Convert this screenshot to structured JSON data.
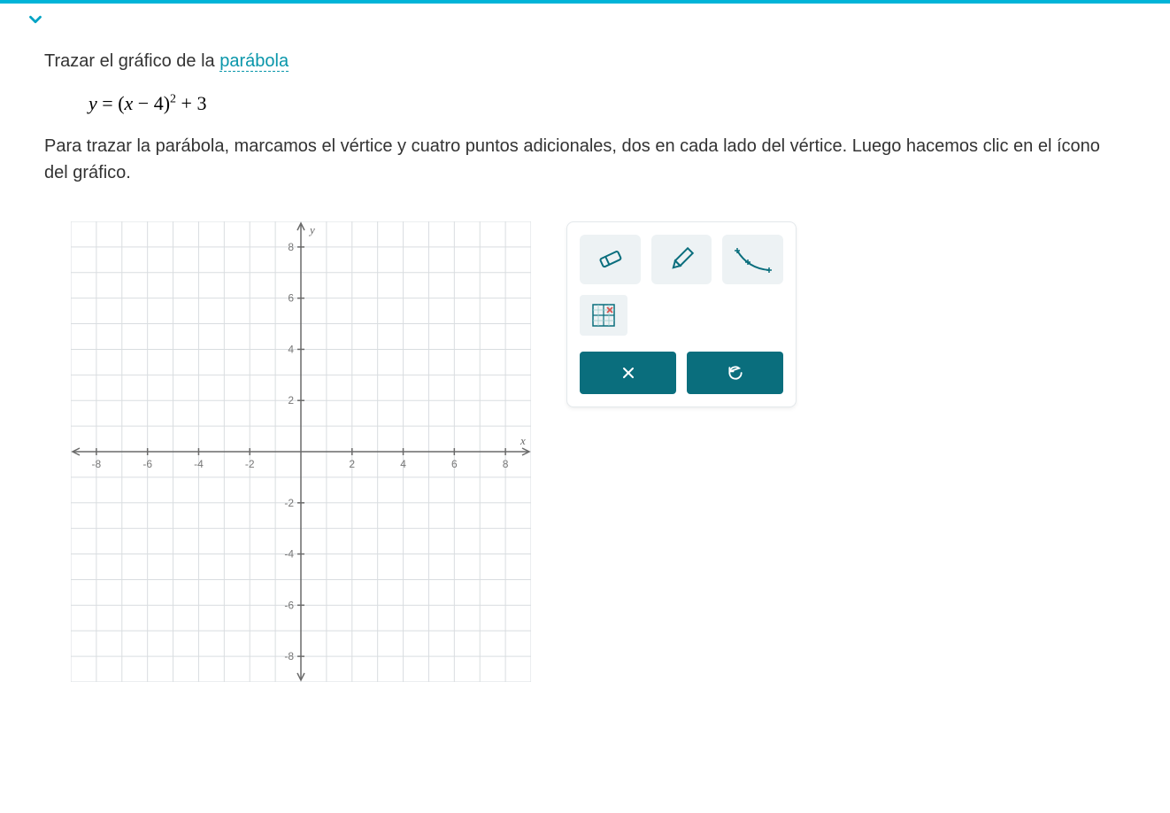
{
  "instruction_prefix": "Trazar el gráfico de la ",
  "instruction_link": "parábola",
  "equation": {
    "raw_tex": "y = (x - 4)^2 + 3",
    "lhs": "y",
    "rhs_open": "(",
    "var": "x",
    "minus": " − ",
    "h": "4",
    "rhs_close": ")",
    "exp": "2",
    "plus": " + ",
    "k": "3"
  },
  "sub_instruction": "Para trazar la parábola, marcamos el vértice y cuatro puntos adicionales, dos en cada lado del vértice. Luego hacemos clic en el ícono del gráfico.",
  "chart_data": {
    "type": "scatter",
    "title": "",
    "xlabel": "x",
    "ylabel": "y",
    "xlim": [
      -9,
      9
    ],
    "ylim": [
      -9,
      9
    ],
    "x_ticks": [
      -8,
      -6,
      -4,
      -2,
      2,
      4,
      6,
      8
    ],
    "y_ticks": [
      -8,
      -6,
      -4,
      -2,
      2,
      4,
      6,
      8
    ],
    "series": []
  },
  "tools": {
    "eraser": "eraser-icon",
    "pencil": "pencil-icon",
    "curve": "curve-icon",
    "zoom": "zoom-region-icon"
  },
  "actions": {
    "clear": "clear",
    "undo": "undo"
  }
}
